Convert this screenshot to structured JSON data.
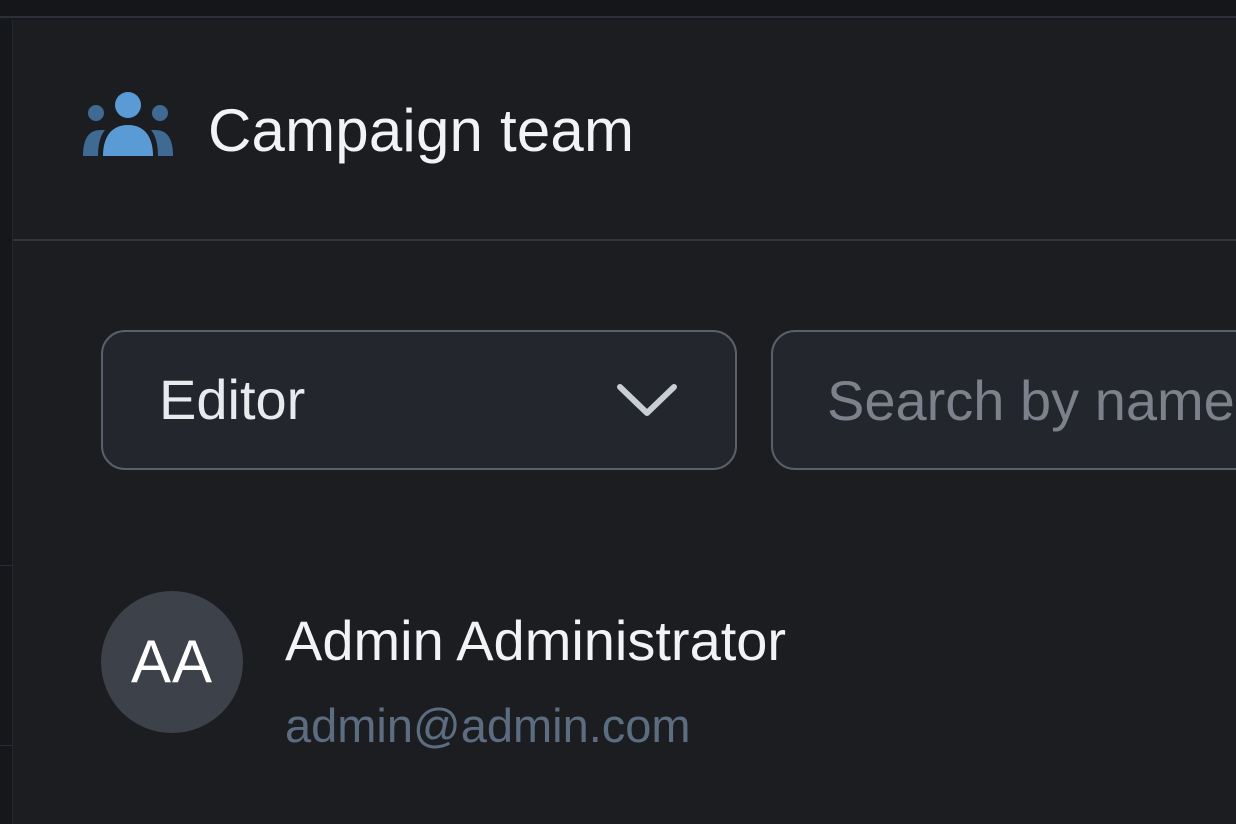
{
  "panel": {
    "title": "Campaign team",
    "icon": "users-group-icon"
  },
  "filters": {
    "role_select": {
      "selected": "Editor",
      "icon": "chevron-down-icon"
    },
    "search": {
      "placeholder": "Search by name",
      "value": ""
    }
  },
  "members": [
    {
      "initials": "AA",
      "name": "Admin Administrator",
      "email": "admin@admin.com"
    }
  ],
  "colors": {
    "background": "#1c1d21",
    "accent_icon": "#5b9bd5",
    "email_text": "#5c6d82",
    "avatar_bg": "#3d414a",
    "input_border": "#5a5f69"
  }
}
